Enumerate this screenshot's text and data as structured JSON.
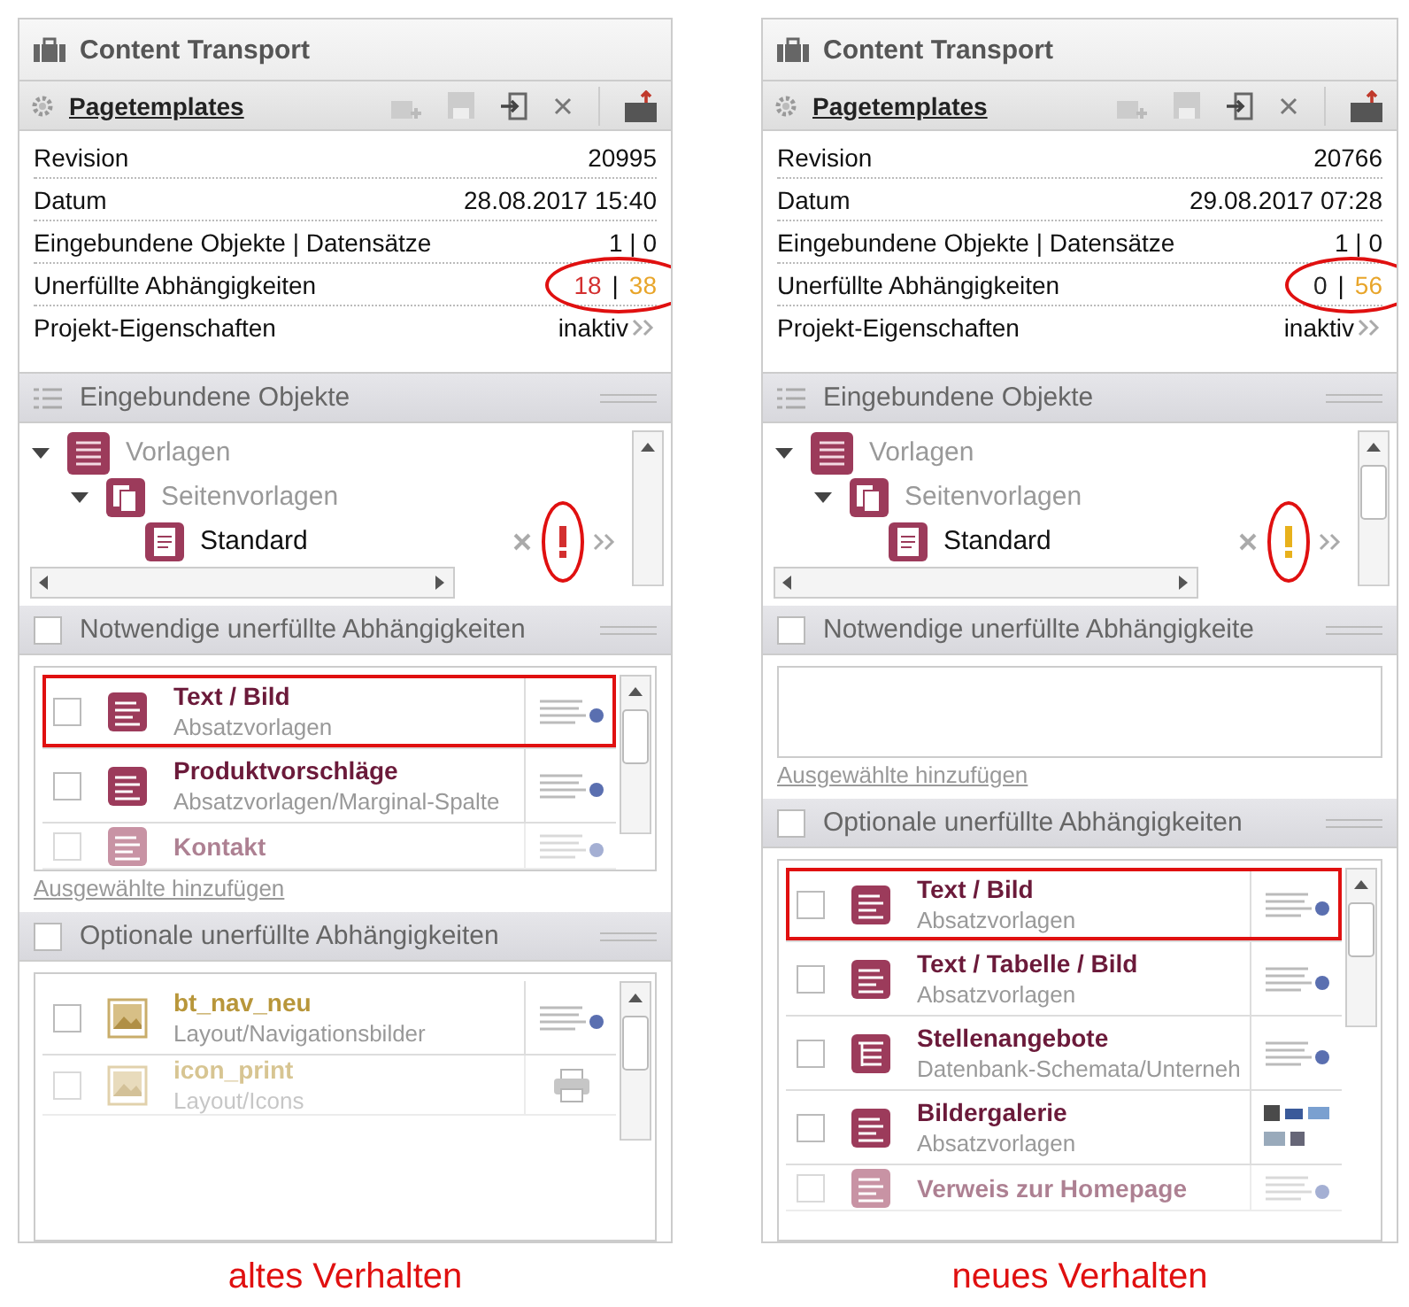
{
  "panels": [
    {
      "title": "Content Transport",
      "toolbar": {
        "label": "Pagetemplates"
      },
      "properties": [
        {
          "kind": "text",
          "label": "Revision",
          "value": "20995"
        },
        {
          "kind": "text",
          "label": "Datum",
          "value": "28.08.2017 15:40"
        },
        {
          "kind": "text",
          "label": "Eingebundene Objekte | Datensätze",
          "value": "1 | 0"
        },
        {
          "kind": "counts",
          "label": "Unerfüllte Abhängigkeiten",
          "required": "18",
          "required_open": true,
          "separator": "|",
          "optional": "38",
          "circled": true
        },
        {
          "kind": "link",
          "label": "Projekt-Eigenschaften",
          "value": "inaktiv"
        }
      ],
      "objects_section": {
        "title": "Eingebundene Objekte"
      },
      "tree": [
        {
          "kind": "templates",
          "label": "Vorlagen",
          "expanded": true,
          "children": [
            {
              "kind": "page-templates",
              "label": "Seitenvorlagen",
              "expanded": true,
              "children": [
                {
                  "kind": "page",
                  "label": "Standard",
                  "warning": {
                    "kind": "required"
                  },
                  "circled": true
                }
              ]
            }
          ]
        }
      ],
      "required_section": {
        "title": "Notwendige unerfüllte Abhängigkeiten",
        "checked": false
      },
      "required_items": [
        {
          "kind": "paragraph",
          "title": "Text / Bild",
          "path": "Absatzvorlagen",
          "checked": false,
          "faded": false,
          "highlighted": true,
          "preview": {
            "kind": "thumbnail"
          }
        },
        {
          "kind": "paragraph",
          "title": "Produktvorschläge",
          "path": "Absatzvorlagen/Marginal-Spalte",
          "checked": false,
          "faded": false,
          "highlighted": false,
          "preview": {
            "kind": "thumbnail"
          }
        },
        {
          "kind": "paragraph",
          "title": "Kontakt",
          "checked": false,
          "faded": true,
          "highlighted": false,
          "preview": {
            "kind": "thumbnail"
          }
        }
      ],
      "add_link": "Ausgewählte hinzufügen",
      "optional_section": {
        "title": "Optionale unerfüllte Abhängigkeiten",
        "checked": false
      },
      "optional_items": [
        {
          "kind": "image",
          "title": "bt_nav_neu",
          "path": "Layout/Navigationsbilder",
          "checked": false,
          "faded": false,
          "highlighted": false,
          "preview": {
            "kind": "thumbnail"
          }
        },
        {
          "kind": "image",
          "title": "icon_print",
          "path": "Layout/Icons",
          "checked": false,
          "faded": true,
          "highlighted": false,
          "preview": {
            "kind": "printer"
          }
        }
      ],
      "caption": "altes Verhalten"
    },
    {
      "title": "Content Transport",
      "toolbar": {
        "label": "Pagetemplates"
      },
      "properties": [
        {
          "kind": "text",
          "label": "Revision",
          "value": "20766"
        },
        {
          "kind": "text",
          "label": "Datum",
          "value": "29.08.2017 07:28"
        },
        {
          "kind": "text",
          "label": "Eingebundene Objekte | Datensätze",
          "value": "1 | 0"
        },
        {
          "kind": "counts",
          "label": "Unerfüllte Abhängigkeiten",
          "required": "0",
          "required_open": false,
          "separator": "|",
          "optional": "56",
          "circled": true
        },
        {
          "kind": "link",
          "label": "Projekt-Eigenschaften",
          "value": "inaktiv"
        }
      ],
      "objects_section": {
        "title": "Eingebundene Objekte"
      },
      "tree": [
        {
          "kind": "templates",
          "label": "Vorlagen",
          "expanded": true,
          "children": [
            {
              "kind": "page-templates",
              "label": "Seitenvorlagen",
              "expanded": true,
              "children": [
                {
                  "kind": "page",
                  "label": "Standard",
                  "warning": {
                    "kind": "optional"
                  },
                  "circled": true
                }
              ]
            }
          ]
        }
      ],
      "required_section": {
        "title": "Notwendige unerfüllte Abhängigkeite",
        "checked": false
      },
      "add_link": "Ausgewählte hinzufügen",
      "optional_section": {
        "title": "Optionale unerfüllte Abhängigkeiten",
        "checked": false
      },
      "optional_items": [
        {
          "kind": "paragraph",
          "title": "Text / Bild",
          "path": "Absatzvorlagen",
          "checked": false,
          "faded": false,
          "highlighted": true,
          "preview": {
            "kind": "thumbnail"
          }
        },
        {
          "kind": "paragraph",
          "title": "Text / Tabelle / Bild",
          "path": "Absatzvorlagen",
          "checked": false,
          "faded": false,
          "highlighted": false,
          "preview": {
            "kind": "thumbnail"
          }
        },
        {
          "kind": "schema",
          "title": "Stellenangebote",
          "path": "Datenbank-Schemata/Unterneh",
          "checked": false,
          "faded": false,
          "highlighted": false,
          "preview": {
            "kind": "thumbnail"
          }
        },
        {
          "kind": "paragraph",
          "title": "Bildergalerie",
          "path": "Absatzvorlagen",
          "checked": false,
          "faded": false,
          "highlighted": false,
          "preview": {
            "kind": "photos"
          }
        },
        {
          "kind": "paragraph",
          "title": "Verweis zur Homepage",
          "checked": false,
          "faded": true,
          "highlighted": false,
          "preview": {
            "kind": "thumbnail"
          }
        }
      ],
      "caption": "neues Verhalten"
    }
  ]
}
